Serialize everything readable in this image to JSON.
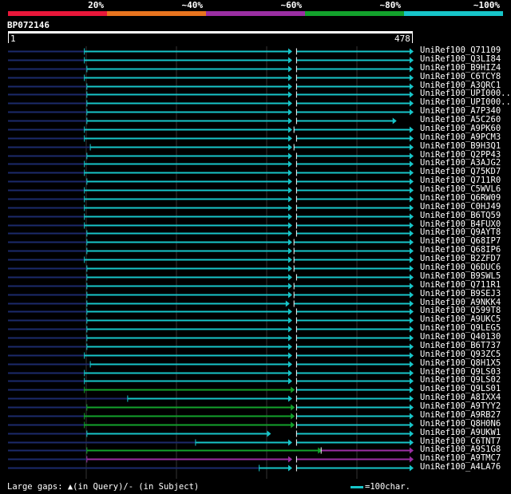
{
  "identity_legend": [
    {
      "label": "20%",
      "color": "#e8173a"
    },
    {
      "label": "~40%",
      "color": "#e8741f"
    },
    {
      "label": "~60%",
      "color": "#9b2fa3"
    },
    {
      "label": "~80%",
      "color": "#13a22c"
    },
    {
      "label": "~100%",
      "color": "#17c5c9"
    }
  ],
  "query": {
    "id": "BP072146",
    "start": 1,
    "end": 478
  },
  "hits": [
    {
      "name": "UniRef100_Q71109",
      "segments": [
        {
          "s": 91,
          "e": 335,
          "c": "cyan"
        },
        {
          "s": 341,
          "e": 478,
          "c": "cyan"
        }
      ],
      "arrow": 335
    },
    {
      "name": "UniRef100_Q3LI84",
      "segments": [
        {
          "s": 91,
          "e": 335,
          "c": "cyan"
        },
        {
          "s": 341,
          "e": 478,
          "c": "cyan"
        }
      ],
      "arrow": 335
    },
    {
      "name": "UniRef100_B9HIZ4",
      "segments": [
        {
          "s": 94,
          "e": 335,
          "c": "cyan"
        },
        {
          "s": 341,
          "e": 478,
          "c": "cyan"
        }
      ]
    },
    {
      "name": "UniRef100_C6TCY8",
      "segments": [
        {
          "s": 91,
          "e": 335,
          "c": "cyan"
        },
        {
          "s": 341,
          "e": 478,
          "c": "cyan"
        }
      ]
    },
    {
      "name": "UniRef100_A3QRC1",
      "segments": [
        {
          "s": 94,
          "e": 335,
          "c": "cyan"
        },
        {
          "s": 341,
          "e": 478,
          "c": "cyan"
        }
      ]
    },
    {
      "name": "UniRef100_UPI000..",
      "segments": [
        {
          "s": 94,
          "e": 335,
          "c": "cyan"
        },
        {
          "s": 341,
          "e": 478,
          "c": "cyan"
        }
      ]
    },
    {
      "name": "UniRef100_UPI000..",
      "segments": [
        {
          "s": 94,
          "e": 335,
          "c": "cyan"
        },
        {
          "s": 341,
          "e": 478,
          "c": "cyan"
        }
      ]
    },
    {
      "name": "UniRef100_A7P340",
      "segments": [
        {
          "s": 94,
          "e": 335,
          "c": "cyan"
        },
        {
          "s": 341,
          "e": 478,
          "c": "cyan"
        }
      ]
    },
    {
      "name": "UniRef100_A5C260",
      "segments": [
        {
          "s": 94,
          "e": 335,
          "c": "cyan"
        },
        {
          "s": 341,
          "e": 458,
          "c": "cyan"
        }
      ]
    },
    {
      "name": "UniRef100_A9PK60",
      "segments": [
        {
          "s": 91,
          "e": 335,
          "c": "cyan"
        },
        {
          "s": 338,
          "e": 478,
          "c": "cyan"
        }
      ]
    },
    {
      "name": "UniRef100_A9PCM3",
      "segments": [
        {
          "s": 91,
          "e": 335,
          "c": "cyan"
        },
        {
          "s": 341,
          "e": 478,
          "c": "cyan"
        }
      ]
    },
    {
      "name": "UniRef100_B9H3Q1",
      "segments": [
        {
          "s": 98,
          "e": 335,
          "c": "cyan"
        },
        {
          "s": 338,
          "e": 478,
          "c": "cyan"
        }
      ]
    },
    {
      "name": "UniRef100_Q2PP43",
      "segments": [
        {
          "s": 94,
          "e": 335,
          "c": "cyan"
        },
        {
          "s": 341,
          "e": 478,
          "c": "cyan"
        }
      ]
    },
    {
      "name": "UniRef100_A3AJG2",
      "segments": [
        {
          "s": 91,
          "e": 335,
          "c": "cyan"
        },
        {
          "s": 341,
          "e": 478,
          "c": "cyan"
        }
      ]
    },
    {
      "name": "UniRef100_Q75KD7",
      "segments": [
        {
          "s": 91,
          "e": 335,
          "c": "cyan"
        },
        {
          "s": 341,
          "e": 478,
          "c": "cyan"
        }
      ]
    },
    {
      "name": "UniRef100_Q711R0",
      "segments": [
        {
          "s": 94,
          "e": 335,
          "c": "cyan"
        },
        {
          "s": 341,
          "e": 478,
          "c": "cyan"
        }
      ]
    },
    {
      "name": "UniRef100_C5WVL6",
      "segments": [
        {
          "s": 91,
          "e": 335,
          "c": "cyan"
        },
        {
          "s": 341,
          "e": 478,
          "c": "cyan"
        }
      ]
    },
    {
      "name": "UniRef100_Q6RW09",
      "segments": [
        {
          "s": 91,
          "e": 335,
          "c": "cyan"
        },
        {
          "s": 341,
          "e": 478,
          "c": "cyan"
        }
      ]
    },
    {
      "name": "UniRef100_C0HJ49",
      "segments": [
        {
          "s": 91,
          "e": 335,
          "c": "cyan"
        },
        {
          "s": 341,
          "e": 478,
          "c": "cyan"
        }
      ]
    },
    {
      "name": "UniRef100_B6TQ59",
      "segments": [
        {
          "s": 91,
          "e": 335,
          "c": "cyan"
        },
        {
          "s": 341,
          "e": 478,
          "c": "cyan"
        }
      ]
    },
    {
      "name": "UniRef100_B4FUX0",
      "segments": [
        {
          "s": 91,
          "e": 335,
          "c": "cyan"
        },
        {
          "s": 341,
          "e": 478,
          "c": "cyan"
        }
      ]
    },
    {
      "name": "UniRef100_Q9AYT8",
      "segments": [
        {
          "s": 94,
          "e": 335,
          "c": "cyan"
        },
        {
          "s": 341,
          "e": 478,
          "c": "cyan"
        }
      ]
    },
    {
      "name": "UniRef100_Q68IP7",
      "segments": [
        {
          "s": 94,
          "e": 335,
          "c": "cyan"
        },
        {
          "s": 338,
          "e": 478,
          "c": "cyan"
        }
      ]
    },
    {
      "name": "UniRef100_Q68IP6",
      "segments": [
        {
          "s": 94,
          "e": 335,
          "c": "cyan"
        },
        {
          "s": 338,
          "e": 478,
          "c": "cyan"
        }
      ]
    },
    {
      "name": "UniRef100_B2ZFD7",
      "segments": [
        {
          "s": 91,
          "e": 335,
          "c": "cyan"
        },
        {
          "s": 338,
          "e": 478,
          "c": "cyan"
        }
      ]
    },
    {
      "name": "UniRef100_Q6DUC6",
      "segments": [
        {
          "s": 94,
          "e": 335,
          "c": "cyan"
        },
        {
          "s": 338,
          "e": 478,
          "c": "cyan"
        }
      ]
    },
    {
      "name": "UniRef100_B9SWL5",
      "segments": [
        {
          "s": 94,
          "e": 335,
          "c": "cyan"
        },
        {
          "s": 341,
          "e": 478,
          "c": "cyan"
        }
      ]
    },
    {
      "name": "UniRef100_Q711R1",
      "segments": [
        {
          "s": 94,
          "e": 335,
          "c": "cyan"
        },
        {
          "s": 338,
          "e": 478,
          "c": "cyan"
        }
      ]
    },
    {
      "name": "UniRef100_B9SEJ3",
      "segments": [
        {
          "s": 94,
          "e": 335,
          "c": "cyan"
        },
        {
          "s": 338,
          "e": 478,
          "c": "cyan"
        }
      ]
    },
    {
      "name": "UniRef100_A9NKK4",
      "segments": [
        {
          "s": 94,
          "e": 332,
          "c": "cyan"
        },
        {
          "s": 338,
          "e": 478,
          "c": "cyan"
        }
      ]
    },
    {
      "name": "UniRef100_Q599T8",
      "segments": [
        {
          "s": 94,
          "e": 335,
          "c": "cyan"
        },
        {
          "s": 341,
          "e": 478,
          "c": "cyan"
        }
      ]
    },
    {
      "name": "UniRef100_A9UKC5",
      "segments": [
        {
          "s": 94,
          "e": 335,
          "c": "cyan"
        },
        {
          "s": 341,
          "e": 478,
          "c": "cyan"
        }
      ]
    },
    {
      "name": "UniRef100_Q9LEG5",
      "segments": [
        {
          "s": 94,
          "e": 335,
          "c": "cyan"
        },
        {
          "s": 341,
          "e": 478,
          "c": "cyan"
        }
      ]
    },
    {
      "name": "UniRef100_Q40130",
      "segments": [
        {
          "s": 94,
          "e": 335,
          "c": "cyan"
        },
        {
          "s": 341,
          "e": 478,
          "c": "cyan"
        }
      ]
    },
    {
      "name": "UniRef100_B6T737",
      "segments": [
        {
          "s": 94,
          "e": 335,
          "c": "cyan"
        },
        {
          "s": 341,
          "e": 478,
          "c": "cyan"
        }
      ]
    },
    {
      "name": "UniRef100_Q93ZC5",
      "segments": [
        {
          "s": 91,
          "e": 335,
          "c": "cyan"
        },
        {
          "s": 341,
          "e": 478,
          "c": "cyan"
        }
      ]
    },
    {
      "name": "UniRef100_Q8H1X5",
      "segments": [
        {
          "s": 98,
          "e": 335,
          "c": "cyan"
        },
        {
          "s": 341,
          "e": 478,
          "c": "cyan"
        }
      ]
    },
    {
      "name": "UniRef100_Q9LS03",
      "segments": [
        {
          "s": 91,
          "e": 335,
          "c": "cyan"
        },
        {
          "s": 341,
          "e": 478,
          "c": "cyan"
        }
      ]
    },
    {
      "name": "UniRef100_Q9LS02",
      "segments": [
        {
          "s": 91,
          "e": 335,
          "c": "cyan"
        },
        {
          "s": 341,
          "e": 478,
          "c": "cyan"
        }
      ]
    },
    {
      "name": "UniRef100_Q9LS01",
      "segments": [
        {
          "s": 91,
          "e": 338,
          "c": "green"
        },
        {
          "s": 341,
          "e": 478,
          "c": "cyan"
        }
      ]
    },
    {
      "name": "UniRef100_A8IXX4",
      "segments": [
        {
          "s": 142,
          "e": 335,
          "c": "cyan"
        },
        {
          "s": 341,
          "e": 478,
          "c": "cyan"
        }
      ]
    },
    {
      "name": "UniRef100_A9TYY2",
      "segments": [
        {
          "s": 94,
          "e": 338,
          "c": "green"
        },
        {
          "s": 341,
          "e": 478,
          "c": "cyan"
        }
      ]
    },
    {
      "name": "UniRef100_A9RB27",
      "segments": [
        {
          "s": 91,
          "e": 338,
          "c": "green"
        },
        {
          "s": 341,
          "e": 478,
          "c": "cyan"
        }
      ]
    },
    {
      "name": "UniRef100_Q8H0N6",
      "segments": [
        {
          "s": 91,
          "e": 338,
          "c": "green"
        },
        {
          "s": 341,
          "e": 478,
          "c": "cyan"
        }
      ]
    },
    {
      "name": "UniRef100_A9UKW1",
      "segments": [
        {
          "s": 94,
          "e": 310,
          "c": "cyan"
        },
        {
          "s": 341,
          "e": 478,
          "c": "cyan"
        }
      ]
    },
    {
      "name": "UniRef100_C6TNT7",
      "segments": [
        {
          "s": 222,
          "e": 335,
          "c": "cyan"
        },
        {
          "s": 341,
          "e": 478,
          "c": "cyan"
        }
      ]
    },
    {
      "name": "UniRef100_A9S1G8",
      "segments": [
        {
          "s": 94,
          "e": 370,
          "c": "green"
        },
        {
          "s": 370,
          "e": 478,
          "c": "purple"
        }
      ]
    },
    {
      "name": "UniRef100_A9TMC7",
      "segments": [
        {
          "s": 94,
          "e": 335,
          "c": "purple"
        },
        {
          "s": 341,
          "e": 478,
          "c": "purple"
        }
      ]
    },
    {
      "name": "UniRef100_A4LA76",
      "segments": [
        {
          "s": 297,
          "e": 335,
          "c": "cyan"
        },
        {
          "s": 341,
          "e": 478,
          "c": "cyan"
        }
      ]
    }
  ],
  "footer": {
    "gaps_legend": "Large gaps: ▲(in Query)/- (in Subject)",
    "scale_label": "=100char."
  },
  "colors": {
    "cyan": "#17c5c9",
    "green": "#13a22c",
    "purple": "#9b2fa3",
    "navy": "#1b2a6b",
    "grid": "#333333"
  }
}
